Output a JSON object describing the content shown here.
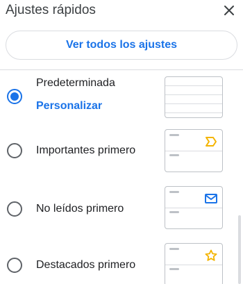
{
  "header": {
    "title": "Ajustes rápidos",
    "see_all_label": "Ver todos los ajustes"
  },
  "options": [
    {
      "label": "Predeterminada",
      "link": "Personalizar",
      "selected": true
    },
    {
      "label": "Importantes primero",
      "selected": false,
      "icon": "important-marker-icon"
    },
    {
      "label": "No leídos primero",
      "selected": false,
      "icon": "mail-icon"
    },
    {
      "label": "Destacados primero",
      "selected": false,
      "icon": "star-icon"
    }
  ],
  "colors": {
    "accent": "#1a73e8",
    "important": "#f4b400",
    "star": "#f4b400",
    "mail": "#1a73e8"
  }
}
